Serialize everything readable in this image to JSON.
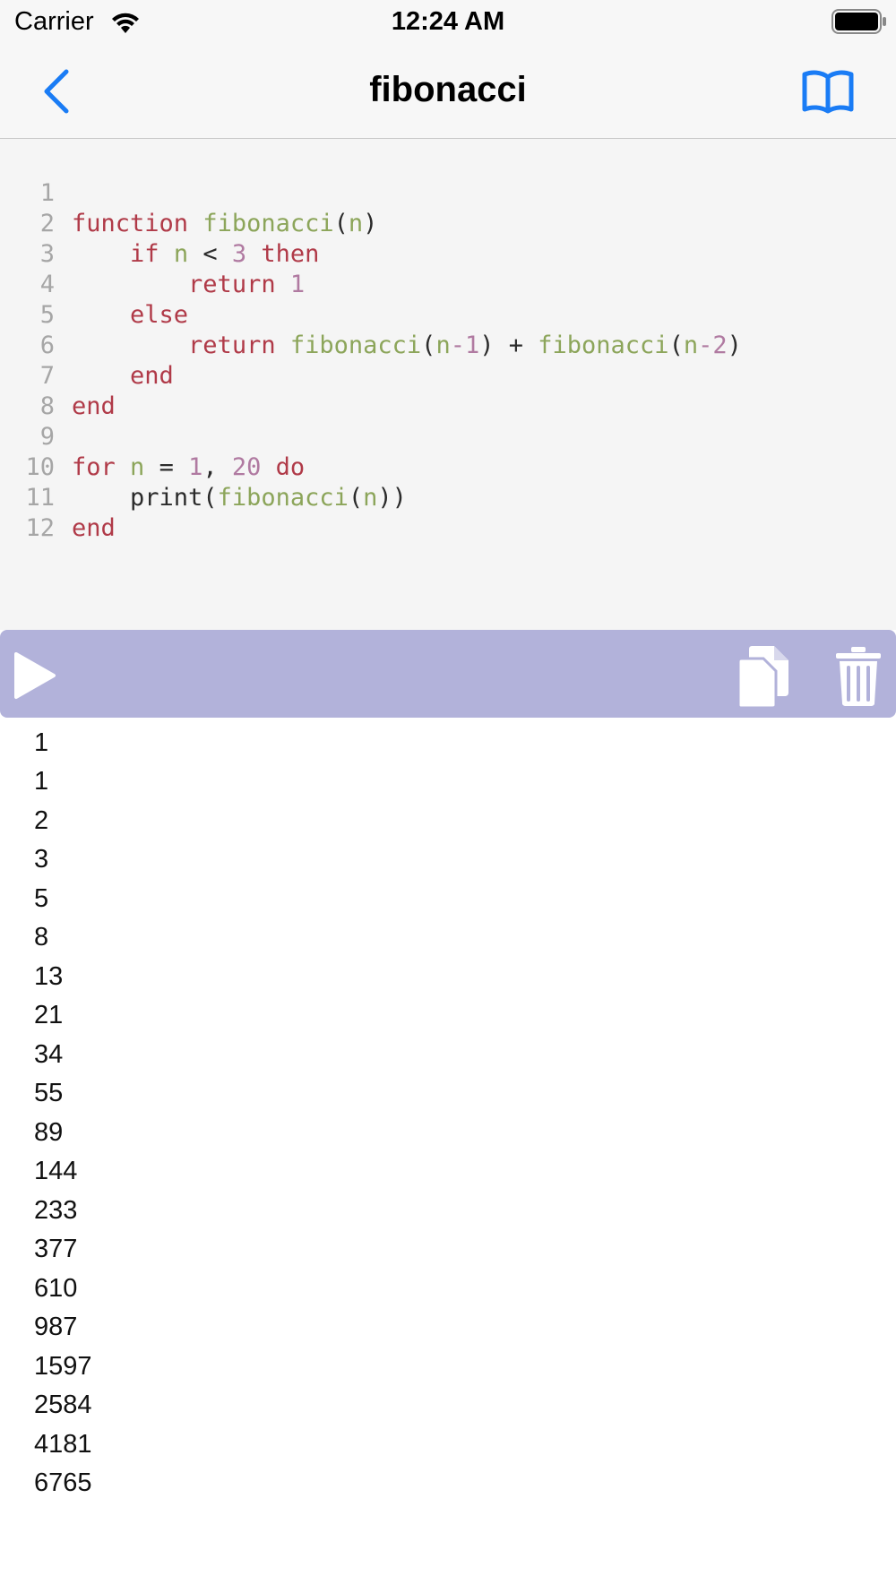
{
  "status_bar": {
    "carrier": "Carrier",
    "time": "12:24 AM"
  },
  "nav": {
    "title": "fibonacci",
    "back_icon": "chevron-left-icon",
    "docs_icon": "book-icon",
    "accent_color": "#1a7cf5"
  },
  "editor": {
    "line_numbers": [
      "1",
      "2",
      "3",
      "4",
      "5",
      "6",
      "7",
      "8",
      "9",
      "10",
      "11",
      "12"
    ],
    "lines": [
      "function fibonacci(n)",
      "    if n < 3 then",
      "        return 1",
      "    else",
      "        return fibonacci(n-1) + fibonacci(n-2)",
      "    end",
      "end",
      "",
      "for n = 1, 20 do",
      "    print(fibonacci(n))",
      "end",
      ""
    ],
    "colors": {
      "keyword": "#b03a48",
      "function": "#8ca55a",
      "number": "#b07aa1",
      "line_number": "#a6a6a6",
      "background": "#f5f5f5"
    }
  },
  "toolbar": {
    "run_icon": "play-icon",
    "copy_icon": "copy-icon",
    "clear_icon": "trash-icon",
    "background": "#b2b2da"
  },
  "output": {
    "lines": [
      "1",
      "1",
      "2",
      "3",
      "5",
      "8",
      "13",
      "21",
      "34",
      "55",
      "89",
      "144",
      "233",
      "377",
      "610",
      "987",
      "1597",
      "2584",
      "4181",
      "6765"
    ]
  }
}
